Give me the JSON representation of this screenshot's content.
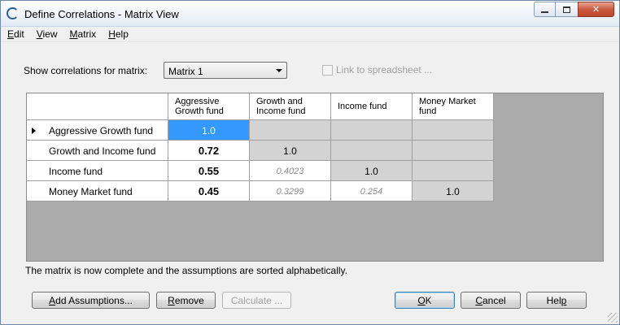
{
  "window": {
    "title": "Define Correlations - Matrix View"
  },
  "menu": {
    "items": [
      {
        "label_u": "E",
        "label_rest": "dit"
      },
      {
        "label_u": "V",
        "label_rest": "iew"
      },
      {
        "label_u": "M",
        "label_rest": "atrix"
      },
      {
        "label_u": "H",
        "label_rest": "elp"
      }
    ]
  },
  "controls": {
    "show_label": "Show correlations for matrix:",
    "matrix_select_value": "Matrix 1",
    "link_label": "Link to spreadsheet ..."
  },
  "grid": {
    "columns": [
      "Aggressive\nGrowth fund",
      "Growth and\nIncome fund",
      "Income fund",
      "Money Market\nfund"
    ],
    "rows": [
      {
        "label": "Aggressive Growth fund",
        "cells": [
          "1.0",
          "",
          "",
          ""
        ]
      },
      {
        "label": "Growth and Income fund",
        "cells": [
          "0.72",
          "1.0",
          "",
          ""
        ]
      },
      {
        "label": "Income fund",
        "cells": [
          "0.55",
          "0.4023",
          "1.0",
          ""
        ]
      },
      {
        "label": "Money Market fund",
        "cells": [
          "0.45",
          "0.3299",
          "0.254",
          "1.0"
        ]
      }
    ]
  },
  "status_text": "The matrix is now complete and the assumptions are sorted alphabetically.",
  "buttons": {
    "add_u": "A",
    "add_rest": "dd Assumptions...",
    "remove_u": "R",
    "remove_rest": "emove",
    "calculate": "Calculate ...",
    "ok_u": "O",
    "ok_rest": "K",
    "cancel_u": "C",
    "cancel_rest": "ancel",
    "help_pre": "Hel",
    "help_u": "p"
  }
}
